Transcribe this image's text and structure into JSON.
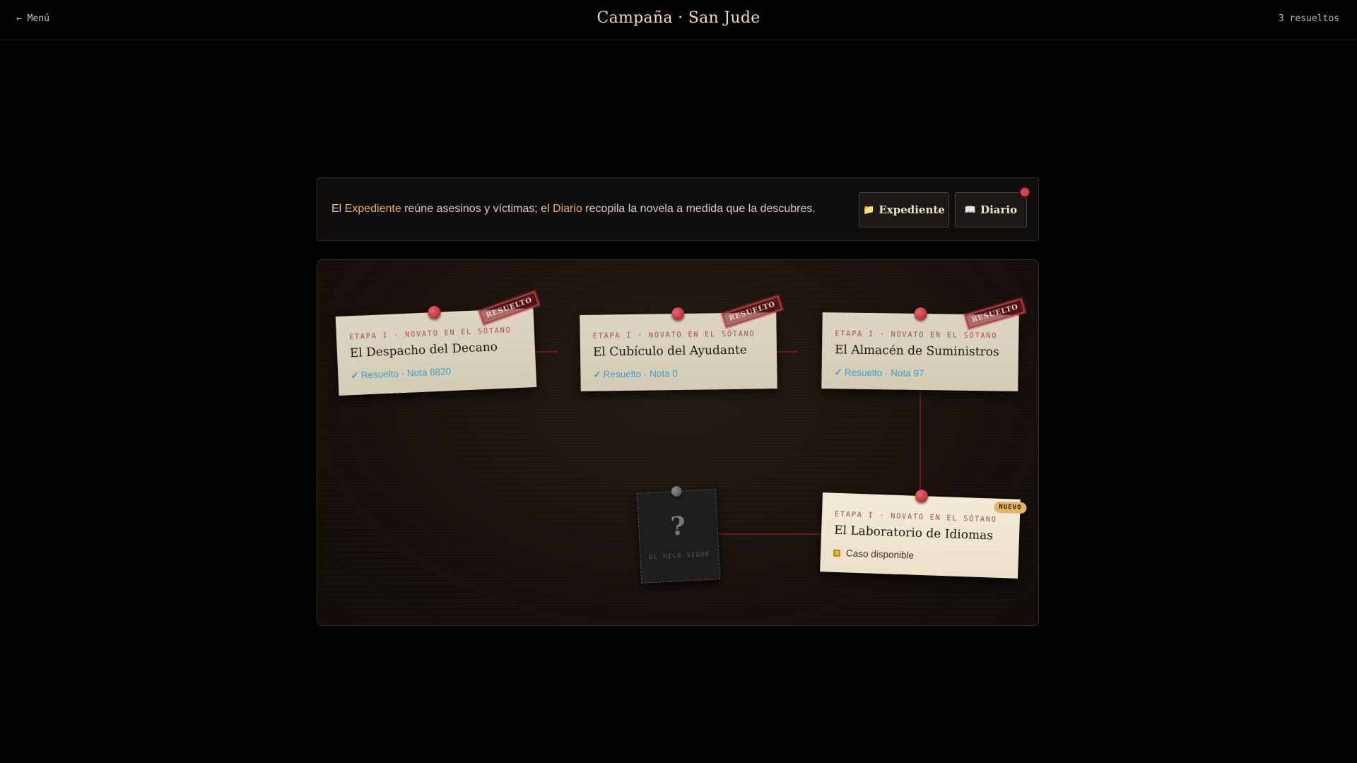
{
  "header": {
    "back_label": "← Menú",
    "title": "Campaña · San Jude",
    "results": "3 resueltos"
  },
  "intro": {
    "text_1": "El ",
    "expediente_word": "Expediente",
    "text_2": " reúne asesinos y víctimas; el ",
    "diario_word": "Diario",
    "text_3": " recopila la novela a medida que la descubres.",
    "expediente_button": "Expediente",
    "diario_button": "Diario",
    "expediente_icon": "📁",
    "diario_icon": "📖"
  },
  "cases": [
    {
      "stage": "ETAPA I · NOVATO EN EL SÓTANO",
      "title": "El Despacho del Decano",
      "status": "Resuelto · Nota 8820",
      "stamp": "RESUELTO"
    },
    {
      "stage": "ETAPA I · NOVATO EN EL SÓTANO",
      "title": "El Cubículo del Ayudante",
      "status": "Resuelto · Nota 0",
      "stamp": "RESUELTO"
    },
    {
      "stage": "ETAPA I · NOVATO EN EL SÓTANO",
      "title": "El Almacén de Suministros",
      "status": "Resuelto · Nota 97",
      "stamp": "RESUELTO"
    },
    {
      "stage": "ETAPA I · NOVATO EN EL SÓTANO",
      "title": "El Laboratorio de Idiomas",
      "status": "Caso disponible",
      "badge": "NUEVO"
    }
  ],
  "mystery": {
    "symbol": "?",
    "hint": "EL HILO SIGUE"
  },
  "colors": {
    "accent": "#e3b266",
    "pin": "#c23540",
    "resolved": "#3f9cc7"
  }
}
